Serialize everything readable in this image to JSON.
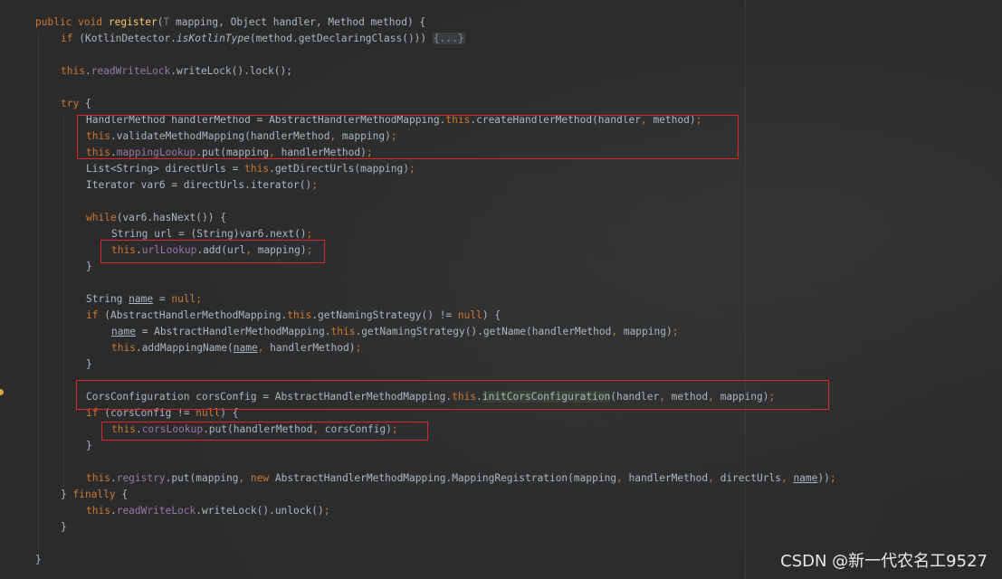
{
  "colors": {
    "background": "#2b2b2b",
    "keyword": "#cc7832",
    "method_decl": "#ffc66d",
    "field": "#9876aa",
    "plain": "#a9b7c6",
    "highlight_box": "#e0242a"
  },
  "code": {
    "l1": {
      "kw1": "public",
      "kw2": "void",
      "fn": "register",
      "a": "(",
      "generic": "T",
      "b": " mapping, Object handler, Method method) {"
    },
    "l2": {
      "kw": "if",
      "a": " (KotlinDetector.",
      "m": "isKotlinType",
      "b": "(method.getDeclaringClass())) ",
      "fold": "{...}"
    },
    "l3": {
      "kw": "this",
      "a": ".",
      "fld": "readWriteLock",
      "b": ".writeLock().lock();"
    },
    "l4": {
      "kw": "try",
      "a": " {"
    },
    "l5": {
      "a": "HandlerMethod handlerMethod = AbstractHandlerMethodMapping.",
      "kw": "this",
      "b": ".createHandlerMethod(handler",
      "c1": ",",
      "c": " method)",
      "d": ";"
    },
    "l6": {
      "kw": "this",
      "a": ".validateMethodMapping(handlerMethod",
      "c1": ",",
      "b": " mapping)",
      "d": ";"
    },
    "l7": {
      "kw": "this",
      "a": ".",
      "fld": "mappingLookup",
      "b": ".put(mapping",
      "c1": ",",
      "c": " handlerMethod)",
      "d": ";"
    },
    "l8": {
      "a": "List<String> directUrls = ",
      "kw": "this",
      "b": ".getDirectUrls(mapping)",
      "d": ";"
    },
    "l9": {
      "a": "Iterator var6 = directUrls.iterator()",
      "d": ";"
    },
    "l10": {
      "kw": "while",
      "a": "(var6.hasNext()) {"
    },
    "l11": {
      "a": "String url = (String)var6.next()",
      "d": ";"
    },
    "l12": {
      "kw": "this",
      "a": ".",
      "fld": "urlLookup",
      "b": ".add(url",
      "c1": ",",
      "c": " mapping)",
      "d": ";"
    },
    "l13": {
      "a": "}"
    },
    "l14": {
      "a": "String ",
      "var": "name",
      "b": " = ",
      "kw": "null",
      "d": ";"
    },
    "l15": {
      "kw": "if",
      "a": " (AbstractHandlerMethodMapping.",
      "kw2": "this",
      "b": ".getNamingStrategy() != ",
      "kw3": "null",
      "c": ") {"
    },
    "l16": {
      "var": "name",
      "a": " = AbstractHandlerMethodMapping.",
      "kw": "this",
      "b": ".getNamingStrategy().getName(handlerMethod",
      "c1": ",",
      "c": " mapping)",
      "d": ";"
    },
    "l17": {
      "kw": "this",
      "a": ".addMappingName(",
      "var": "name",
      "c1": ",",
      "b": " handlerMethod)",
      "d": ";"
    },
    "l18": {
      "a": "}"
    },
    "l19": {
      "a": "CorsConfiguration corsConfig = AbstractHandlerMethodMapping.",
      "kw": "this",
      "b": ".",
      "hl": "initCorsConfiguration",
      "c": "(handler",
      "c1": ",",
      "c2": " method",
      "c3": ",",
      "c4": " mapping)",
      "d": ";"
    },
    "l20": {
      "kw": "if",
      "a": " (corsConfig != ",
      "kw2": "null",
      "b": ") {"
    },
    "l21": {
      "kw": "this",
      "a": ".",
      "fld": "corsLookup",
      "b": ".put(handlerMethod",
      "c1": ",",
      "c": " corsConfig)",
      "d": ";"
    },
    "l22": {
      "a": "}"
    },
    "l23": {
      "kw": "this",
      "a": ".",
      "fld": "registry",
      "b": ".put(mapping",
      "c1": ",",
      "kw2": " new",
      "c": " AbstractHandlerMethodMapping.MappingRegistration(mapping",
      "c2": ",",
      "e": " handlerMethod",
      "c3": ",",
      "f": " directUrls",
      "c4": ",",
      "g": " ",
      "var": "name",
      "h": "))",
      "d": ";"
    },
    "l24": {
      "a": "} ",
      "kw": "finally",
      "b": " {"
    },
    "l25": {
      "kw": "this",
      "a": ".",
      "fld": "readWriteLock",
      "b": ".writeLock().unlock()",
      "d": ";"
    },
    "l26": {
      "a": "}"
    },
    "l27": {
      "a": "}"
    }
  },
  "watermark": "CSDN @新一代农名工9527"
}
